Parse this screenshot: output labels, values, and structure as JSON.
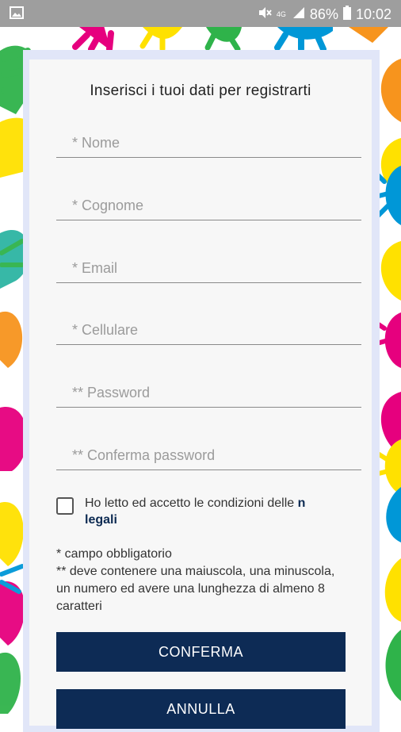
{
  "status_bar": {
    "network": "4G",
    "battery": "86%",
    "time": "10:02",
    "icons": [
      "image-icon",
      "mute-icon",
      "signal-icon",
      "battery-icon"
    ]
  },
  "form": {
    "title": "Inserisci i tuoi dati per registrarti",
    "fields": [
      {
        "placeholder": "* Nome",
        "value": ""
      },
      {
        "placeholder": "* Cognome",
        "value": ""
      },
      {
        "placeholder": "* Email",
        "value": ""
      },
      {
        "placeholder": "* Cellulare",
        "value": ""
      },
      {
        "placeholder": "** Password",
        "value": ""
      },
      {
        "placeholder": "** Conferma password",
        "value": ""
      }
    ],
    "terms_text": "Ho letto ed accetto le condizioni delle ",
    "terms_link": "note legali",
    "terms_link_visible_start": "n",
    "terms_link_visible_end": "legali",
    "note1": "* campo obbligatorio",
    "note2": "** deve contenere una maiuscola, una minuscola, un numero ed avere una lunghezza di almeno 8 caratteri",
    "confirm_label": "CONFERMA",
    "cancel_label": "ANNULLA"
  },
  "colors": {
    "button": "#0d2b55",
    "card": "#f7f7f7",
    "card_border": "#e1e6f8",
    "link": "#0c2a52"
  }
}
